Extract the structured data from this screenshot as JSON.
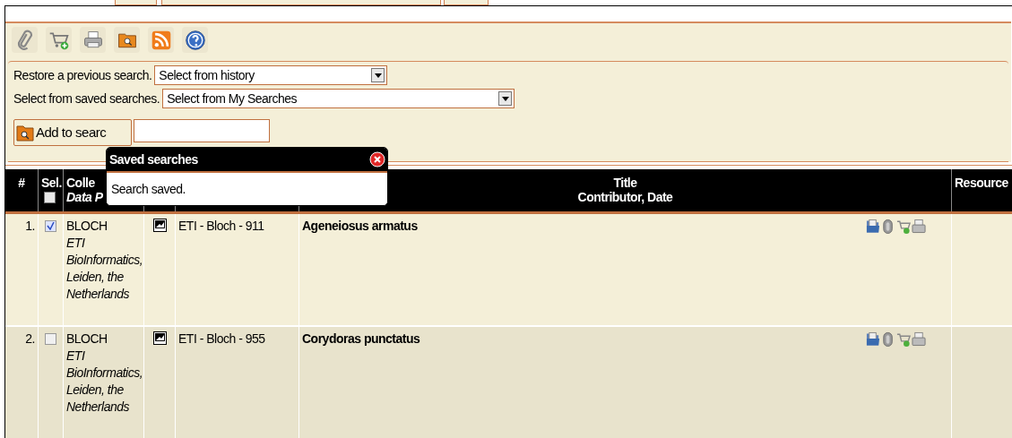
{
  "search_tools": {
    "history_label": "Restore a previous search.",
    "history_select": "Select from history",
    "saved_label": "Select from saved searches.",
    "saved_select": "Select from My Searches",
    "add_button": "Add to searc"
  },
  "popup": {
    "title": "Saved searches",
    "message": "Search saved."
  },
  "table": {
    "columns": [
      {
        "label": "#"
      },
      {
        "label": "Sel.",
        "select_all_checked": false
      },
      {
        "label": "Colle",
        "sublabel": "Data P"
      },
      {},
      {},
      {
        "label": "Title",
        "sublabel": "Contributor, Date"
      },
      {
        "label": "Resource"
      }
    ],
    "rows": [
      {
        "number": "1.",
        "selected": true,
        "collection": "BLOCH",
        "provider": "ETI BioInformatics, Leiden, the Netherlands",
        "identifier": "ETI - Bloch - 911",
        "title": "Ageneiosus armatus"
      },
      {
        "number": "2.",
        "selected": false,
        "collection": "BLOCH",
        "provider": "ETI BioInformatics, Leiden, the Netherlands",
        "identifier": "ETI - Bloch - 955",
        "title": "Corydoras punctatus"
      }
    ]
  }
}
